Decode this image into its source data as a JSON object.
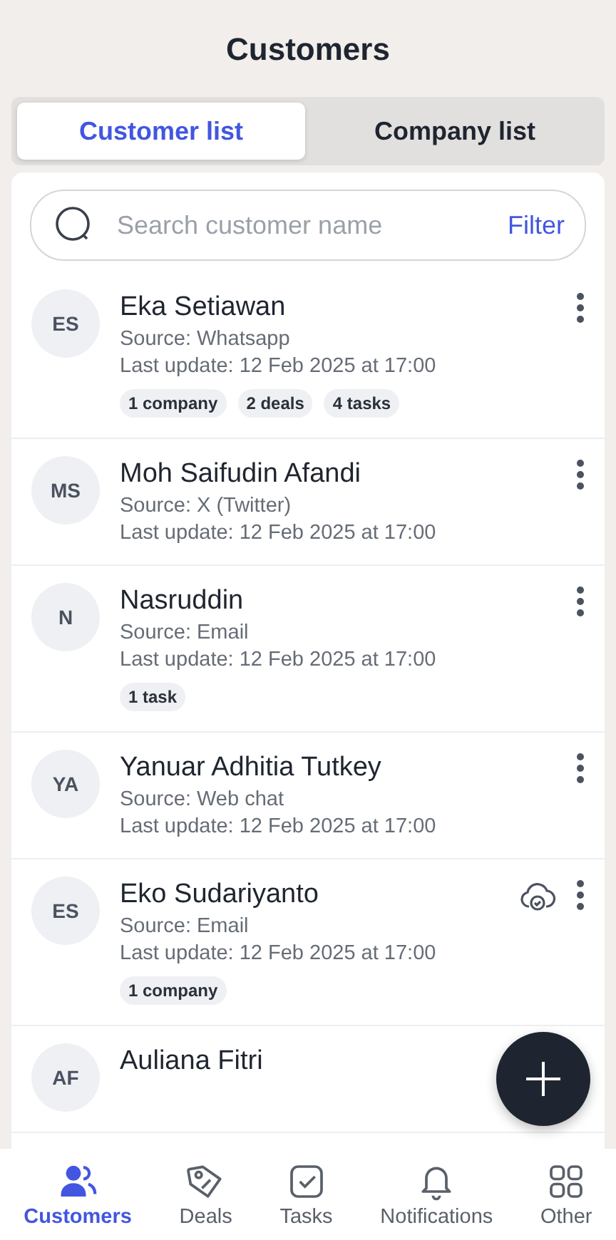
{
  "header": {
    "title": "Customers"
  },
  "tabs": [
    {
      "label": "Customer list",
      "selected": true
    },
    {
      "label": "Company list",
      "selected": false
    }
  ],
  "search": {
    "placeholder": "Search customer name",
    "filter": "Filter"
  },
  "customers": [
    {
      "initials": "ES",
      "name": "Eka Setiawan",
      "source": "Source: Whatsapp",
      "updated": "Last update: 12 Feb 2025 at 17:00",
      "tags": [
        "1 company",
        "2 deals",
        "4 tasks"
      ],
      "cloud": false,
      "menu": true
    },
    {
      "initials": "MS",
      "name": "Moh Saifudin Afandi",
      "source": "Source: X (Twitter)",
      "updated": "Last update: 12 Feb 2025 at 17:00",
      "cloud": false,
      "menu": true
    },
    {
      "initials": "N",
      "name": "Nasruddin",
      "source": "Source: Email",
      "updated": "Last update: 12 Feb 2025 at 17:00",
      "tags": [
        "1 task"
      ],
      "cloud": false,
      "menu": true
    },
    {
      "initials": "YA",
      "name": "Yanuar Adhitia Tutkey",
      "source": "Source: Web chat",
      "updated": "Last update: 12 Feb 2025 at 17:00",
      "cloud": false,
      "menu": true
    },
    {
      "initials": "ES",
      "name": "Eko Sudariyanto",
      "source": "Source: Email",
      "updated": "Last update: 12 Feb 2025 at 17:00",
      "tags": [
        "1 company"
      ],
      "cloud": true,
      "menu": true
    },
    {
      "initials": "AF",
      "name": "Auliana Fitri",
      "cloud": false,
      "menu": false
    }
  ],
  "nav": [
    {
      "kind": "customers",
      "label": "Customers",
      "selected": true
    },
    {
      "kind": "deals",
      "label": "Deals",
      "selected": false
    },
    {
      "kind": "tasks",
      "label": "Tasks",
      "selected": false
    },
    {
      "kind": "notifications",
      "label": "Notifications",
      "selected": false
    },
    {
      "kind": "other",
      "label": "Other",
      "selected": false
    }
  ]
}
